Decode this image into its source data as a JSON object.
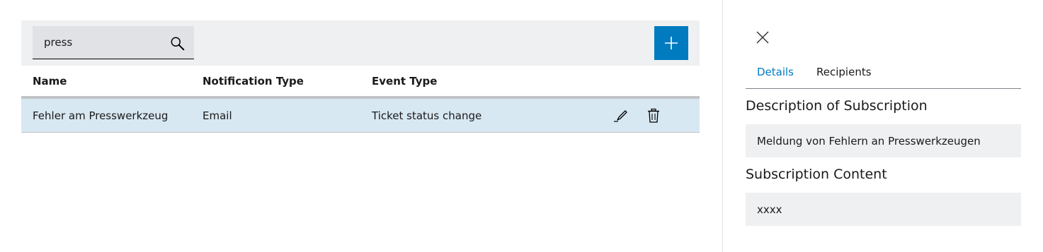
{
  "search": {
    "value": "press",
    "placeholder": "Search"
  },
  "table": {
    "columns": [
      "Name",
      "Notification Type",
      "Event Type"
    ],
    "rows": [
      {
        "name": "Fehler am Presswerkzeug",
        "notification_type": "Email",
        "event_type": "Ticket status change"
      }
    ]
  },
  "panel": {
    "tabs": [
      "Details",
      "Recipients"
    ],
    "active_tab": "Details",
    "description_title": "Description of Subscription",
    "description_value": "Meldung von Fehlern an Presswerkzeugen",
    "content_title": "Subscription Content",
    "content_value": "xxxx"
  },
  "colors": {
    "accent": "#007bc0",
    "selected_row": "#d8e8f2",
    "toolbar_bg": "#eff0f1"
  },
  "icons": [
    "search-icon",
    "plus-icon",
    "edit-icon",
    "delete-icon",
    "close-icon"
  ]
}
